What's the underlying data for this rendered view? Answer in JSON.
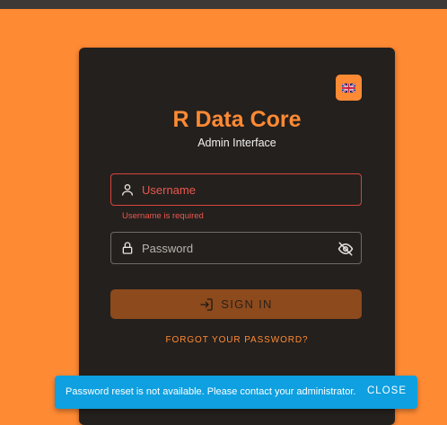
{
  "app": {
    "title": "R Data Core",
    "subtitle": "Admin Interface"
  },
  "language_button": {
    "icon": "uk-flag-icon",
    "label": "English"
  },
  "form": {
    "username": {
      "placeholder": "Username",
      "value": "",
      "helper": "Username is required",
      "icon": "user-icon"
    },
    "password": {
      "placeholder": "Password",
      "value": "",
      "icon": "lock-icon",
      "toggle_icon": "eye-off-icon"
    },
    "signin_label": "SIGN IN",
    "signin_icon": "login-icon",
    "forgot_label": "FORGOT YOUR PASSWORD?"
  },
  "snackbar": {
    "message": "Password reset is not available. Please contact your administrator.",
    "action": "CLOSE"
  },
  "colors": {
    "background": "#ff8a34",
    "card": "#24201d",
    "accent": "#ff8a34",
    "error": "#ea5850",
    "snackbar": "#0ea0e0"
  }
}
